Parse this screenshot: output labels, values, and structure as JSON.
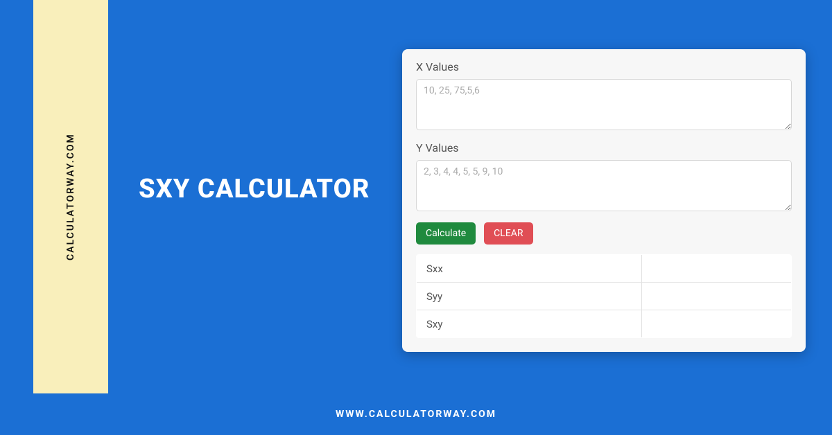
{
  "sidebar": {
    "label": "CALCULATORWAY.COM"
  },
  "title": "SXY CALCULATOR",
  "calculator": {
    "x_label": "X Values",
    "x_placeholder": "10, 25, 75,5,6",
    "y_label": "Y Values",
    "y_placeholder": "2, 3, 4, 4, 5, 5, 9, 10",
    "calculate_label": "Calculate",
    "clear_label": "CLEAR",
    "results": [
      {
        "label": "Sxx",
        "value": ""
      },
      {
        "label": "Syy",
        "value": ""
      },
      {
        "label": "Sxy",
        "value": ""
      }
    ]
  },
  "footer": {
    "url": "WWW.CALCULATORWAY.COM"
  }
}
